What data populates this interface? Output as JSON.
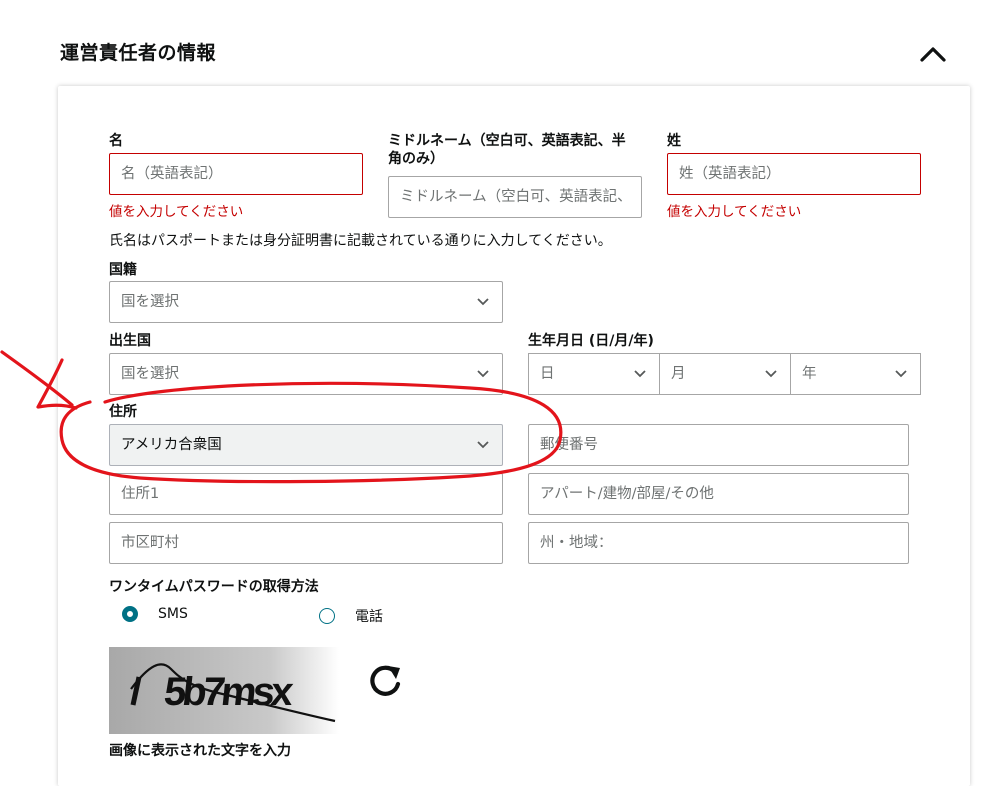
{
  "section": {
    "title": "運営責任者の情報"
  },
  "form": {
    "first_name": {
      "label": "名",
      "placeholder": "名（英語表記）",
      "error": "値を入力してください"
    },
    "middle_name": {
      "label": "ミドルネーム（空白可、英語表記、半角のみ）",
      "placeholder": "ミドルネーム（空白可、英語表記、半角のみ）"
    },
    "last_name": {
      "label": "姓",
      "placeholder": "姓（英語表記）",
      "error": "値を入力してください"
    },
    "name_note": "氏名はパスポートまたは身分証明書に記載されている通りに入力してください。",
    "nationality": {
      "label": "国籍",
      "value": "国を選択"
    },
    "birth_country": {
      "label": "出生国",
      "value": "国を選択"
    },
    "birth_date": {
      "label": "生年月日 (日/月/年)",
      "day": "日",
      "month": "月",
      "year": "年"
    },
    "address": {
      "label": "住所",
      "country": "アメリカ合衆国",
      "postal_placeholder": "郵便番号",
      "address1_placeholder": "住所1",
      "address2_placeholder": "アパート/建物/部屋/その他",
      "city_placeholder": "市区町村",
      "state_placeholder": "州・地域："
    },
    "otp": {
      "label": "ワンタイムパスワードの取得方法",
      "options": [
        {
          "label": "SMS",
          "selected": true
        },
        {
          "label": "電話",
          "selected": false
        }
      ]
    },
    "captcha": {
      "text": "5b7msx",
      "input_label": "画像に表示された文字を入力"
    }
  },
  "colors": {
    "accent": "#007185",
    "error": "#c40000",
    "annotation": "#e3141b"
  },
  "icons": {
    "collapse": "chevron-up-icon",
    "refresh": "refresh-icon",
    "select": "chevron-down-icon"
  }
}
